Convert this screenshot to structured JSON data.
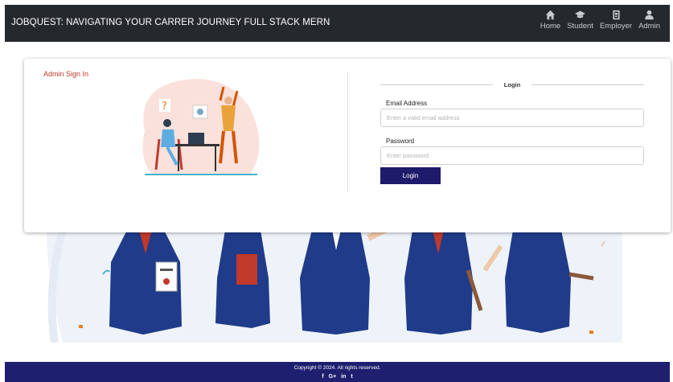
{
  "header": {
    "brand": "JOBQUEST: NAVIGATING YOUR CARRER JOURNEY FULL STACK MERN",
    "nav": [
      {
        "label": "Home",
        "icon": "home-icon"
      },
      {
        "label": "Student",
        "icon": "graduation-cap-icon"
      },
      {
        "label": "Employer",
        "icon": "id-badge-icon"
      },
      {
        "label": "Admin",
        "icon": "user-icon"
      }
    ]
  },
  "card": {
    "title": "Admin Sign In",
    "login_heading": "Login",
    "email_label": "Email Address",
    "email_placeholder": "Enter a valid email address",
    "password_label": "Password",
    "password_placeholder": "Enter password",
    "login_button": "Login"
  },
  "footer": {
    "copyright": "Copyright © 2024. All rights reserved.",
    "social": [
      "f",
      "G+",
      "in",
      "t"
    ]
  },
  "colors": {
    "header_bg": "#25292e",
    "footer_bg": "#1e1f6e",
    "button_bg": "#1e1b6b",
    "title_red": "#c0392b",
    "gown_blue": "#1f3b8a"
  }
}
